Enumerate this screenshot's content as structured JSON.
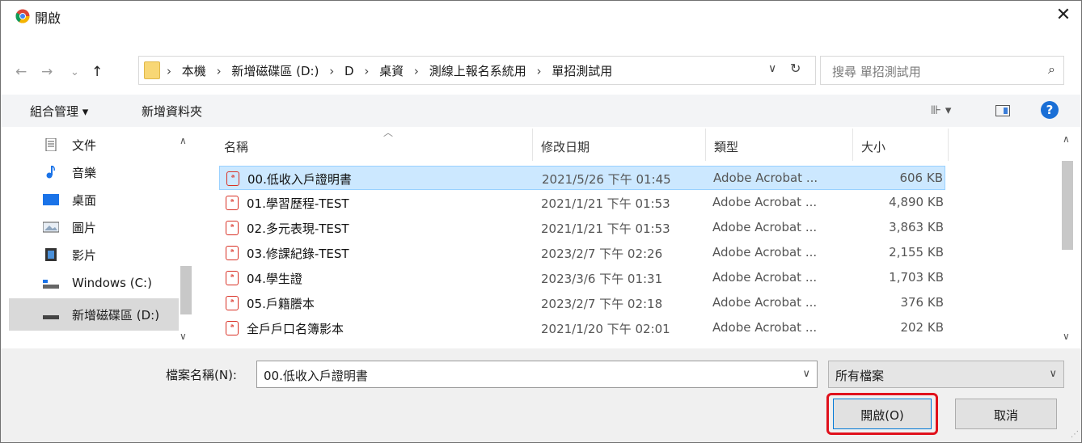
{
  "window": {
    "title": "開啟",
    "close": "✕"
  },
  "nav": {
    "back": "←",
    "forward": "→",
    "recent": "⌄",
    "up": "↑"
  },
  "address": {
    "crumbs": [
      "本機",
      "新增磁碟區 (D:)",
      "D",
      "桌資",
      "測線上報名系統用",
      "單招測試用"
    ],
    "separator": "›",
    "dropdown": "∨",
    "refresh": "↻"
  },
  "search": {
    "placeholder": "搜尋 單招測試用",
    "icon": "⌕"
  },
  "toolbar": {
    "organize": "組合管理 ▾",
    "new_folder": "新增資料夾",
    "view": "⊪ ▾",
    "help": "?"
  },
  "sidebar": {
    "items": [
      {
        "label": "文件",
        "icon": "document-icon"
      },
      {
        "label": "音樂",
        "icon": "music-icon"
      },
      {
        "label": "桌面",
        "icon": "desktop-icon"
      },
      {
        "label": "圖片",
        "icon": "pictures-icon"
      },
      {
        "label": "影片",
        "icon": "videos-icon"
      },
      {
        "label": "Windows (C:)",
        "icon": "drive-icon"
      },
      {
        "label": "新增磁碟區 (D:)",
        "icon": "drive-icon",
        "selected": true
      }
    ]
  },
  "filelist": {
    "columns": [
      "名稱",
      "修改日期",
      "類型",
      "大小"
    ],
    "rows": [
      {
        "name": "00.低收入戶證明書",
        "date": "2021/5/26 下午 01:45",
        "type": "Adobe Acrobat ...",
        "size": "606 KB",
        "selected": true
      },
      {
        "name": "01.學習歷程-TEST",
        "date": "2021/1/21 下午 01:53",
        "type": "Adobe Acrobat ...",
        "size": "4,890 KB"
      },
      {
        "name": "02.多元表現-TEST",
        "date": "2021/1/21 下午 01:53",
        "type": "Adobe Acrobat ...",
        "size": "3,863 KB"
      },
      {
        "name": "03.修課紀錄-TEST",
        "date": "2023/2/7 下午 02:26",
        "type": "Adobe Acrobat ...",
        "size": "2,155 KB"
      },
      {
        "name": "04.學生證",
        "date": "2023/3/6 下午 01:31",
        "type": "Adobe Acrobat ...",
        "size": "1,703 KB"
      },
      {
        "name": "05.戶籍謄本",
        "date": "2023/2/7 下午 02:18",
        "type": "Adobe Acrobat ...",
        "size": "376 KB"
      },
      {
        "name": "全戶戶口名簿影本",
        "date": "2021/1/20 下午 02:01",
        "type": "Adobe Acrobat ...",
        "size": "202 KB"
      }
    ]
  },
  "footer": {
    "filename_label": "檔案名稱(N):",
    "filename_value": "00.低收入戶證明書",
    "filetype": "所有檔案",
    "dropdown": "∨",
    "open_label": "開啟(O)",
    "cancel_label": "取消"
  },
  "colors": {
    "highlight": "#e0111c",
    "selection": "#cce8ff",
    "pdf": "#d93025"
  }
}
